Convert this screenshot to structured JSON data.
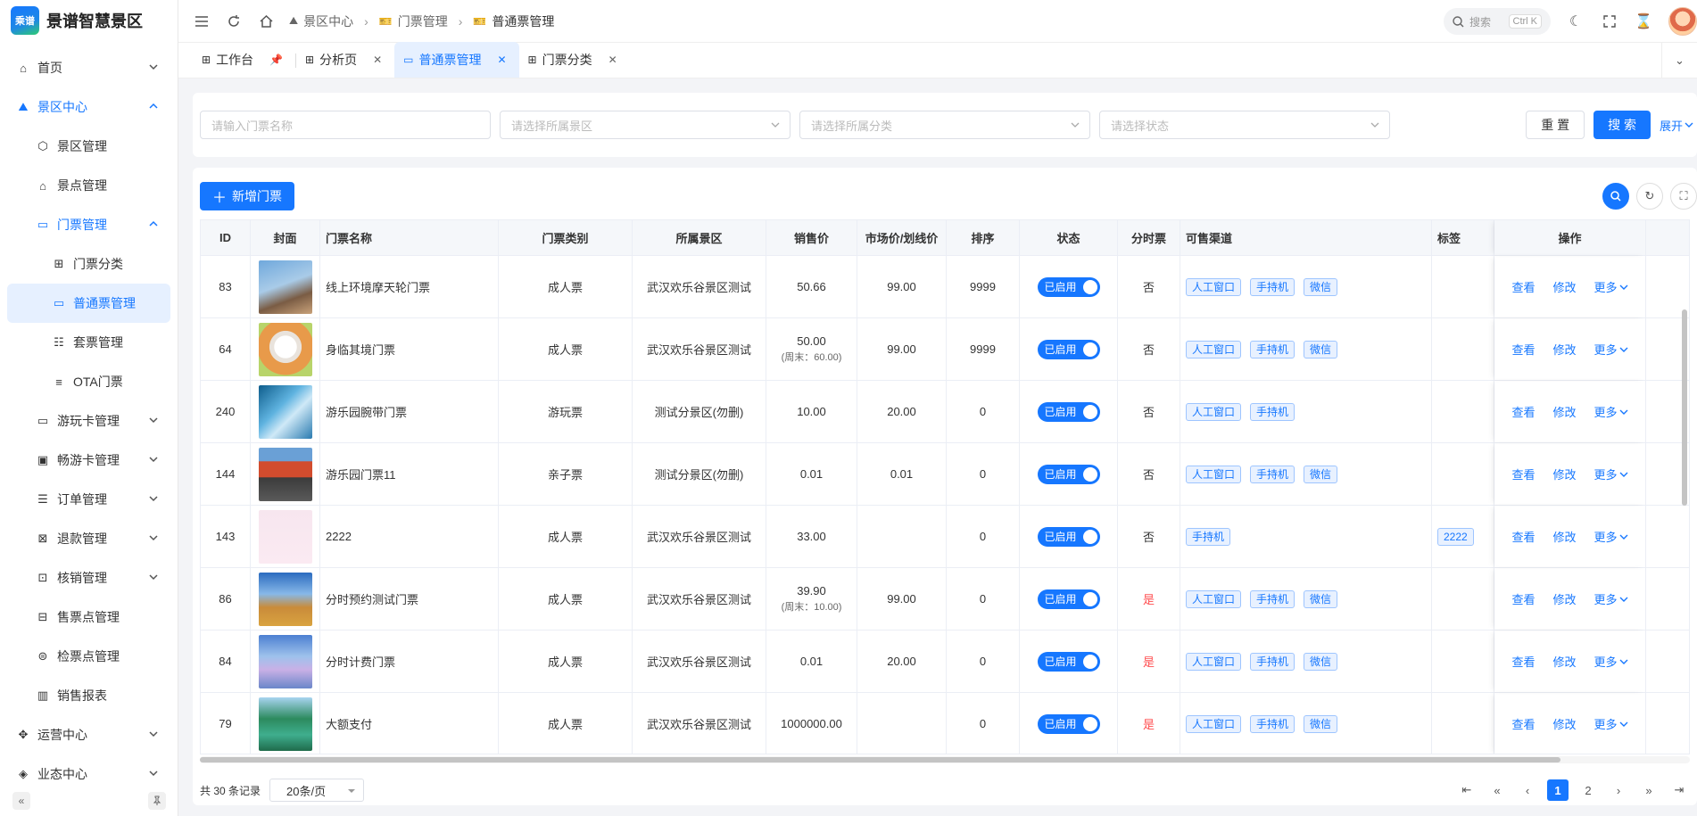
{
  "brand": {
    "logo_text": "乘谱",
    "title": "景谱智慧景区"
  },
  "sidebar": {
    "items": [
      {
        "label": "首页",
        "level": 0,
        "expandable": true,
        "expanded": false
      },
      {
        "label": "景区中心",
        "level": 0,
        "expandable": true,
        "expanded": true,
        "active": true
      },
      {
        "label": "景区管理",
        "level": 1
      },
      {
        "label": "景点管理",
        "level": 1
      },
      {
        "label": "门票管理",
        "level": 1,
        "expandable": true,
        "expanded": true,
        "active": true
      },
      {
        "label": "门票分类",
        "level": 2
      },
      {
        "label": "普通票管理",
        "level": 2,
        "selected": true
      },
      {
        "label": "套票管理",
        "level": 2
      },
      {
        "label": "OTA门票",
        "level": 2
      },
      {
        "label": "游玩卡管理",
        "level": 1,
        "expandable": true
      },
      {
        "label": "畅游卡管理",
        "level": 1,
        "expandable": true
      },
      {
        "label": "订单管理",
        "level": 1,
        "expandable": true
      },
      {
        "label": "退款管理",
        "level": 1,
        "expandable": true
      },
      {
        "label": "核销管理",
        "level": 1,
        "expandable": true
      },
      {
        "label": "售票点管理",
        "level": 1
      },
      {
        "label": "检票点管理",
        "level": 1
      },
      {
        "label": "销售报表",
        "level": 1
      },
      {
        "label": "运营中心",
        "level": 0,
        "expandable": true
      },
      {
        "label": "业态中心",
        "level": 0,
        "expandable": true
      }
    ]
  },
  "header": {
    "breadcrumb": [
      "景区中心",
      "门票管理",
      "普通票管理"
    ],
    "search_placeholder": "搜索",
    "search_shortcut": "Ctrl K"
  },
  "tabs": [
    {
      "label": "工作台",
      "pinned": true
    },
    {
      "label": "分析页",
      "closable": true
    },
    {
      "label": "普通票管理",
      "closable": true,
      "active": true
    },
    {
      "label": "门票分类",
      "closable": true
    }
  ],
  "filters": {
    "name_placeholder": "请输入门票名称",
    "scenic_placeholder": "请选择所属景区",
    "category_placeholder": "请选择所属分类",
    "status_placeholder": "请选择状态",
    "reset_label": "重 置",
    "search_label": "搜 索",
    "expand_label": "展开"
  },
  "toolbar": {
    "add_label": "新增门票"
  },
  "table": {
    "columns": [
      "ID",
      "封面",
      "门票名称",
      "门票类别",
      "所属景区",
      "销售价",
      "市场价/划线价",
      "排序",
      "状态",
      "分时票",
      "可售渠道",
      "标签",
      "操作"
    ],
    "rows": [
      {
        "id": "83",
        "name": "线上环境摩天轮门票",
        "type": "成人票",
        "scenic": "武汉欢乐谷景区测试",
        "price": "50.66",
        "price_sub": "",
        "market": "99.00",
        "sort": "9999",
        "status": "已启用",
        "timed": "否",
        "timed_red": false,
        "channels": [
          "人工窗口",
          "手持机",
          "微信"
        ],
        "tags": [],
        "cover": "ferris"
      },
      {
        "id": "64",
        "name": "身临其境门票",
        "type": "成人票",
        "scenic": "武汉欢乐谷景区测试",
        "price": "50.00",
        "price_sub": "(周末：60.00)",
        "market": "99.00",
        "sort": "9999",
        "status": "已启用",
        "timed": "否",
        "timed_red": false,
        "channels": [
          "人工窗口",
          "手持机",
          "微信"
        ],
        "tags": [],
        "cover": "bunny"
      },
      {
        "id": "240",
        "name": "游乐园腕带门票",
        "type": "游玩票",
        "scenic": "测试分景区(勿删)",
        "price": "10.00",
        "price_sub": "",
        "market": "20.00",
        "sort": "0",
        "status": "已启用",
        "timed": "否",
        "timed_red": false,
        "channels": [
          "人工窗口",
          "手持机"
        ],
        "tags": [],
        "cover": "ice"
      },
      {
        "id": "144",
        "name": "游乐园门票11",
        "type": "亲子票",
        "scenic": "测试分景区(勿删)",
        "price": "0.01",
        "price_sub": "",
        "market": "0.01",
        "sort": "0",
        "status": "已启用",
        "timed": "否",
        "timed_red": false,
        "channels": [
          "人工窗口",
          "手持机",
          "微信"
        ],
        "tags": [],
        "cover": "shop"
      },
      {
        "id": "143",
        "name": "2222",
        "type": "成人票",
        "scenic": "武汉欢乐谷景区测试",
        "price": "33.00",
        "price_sub": "",
        "market": "",
        "sort": "0",
        "status": "已启用",
        "timed": "否",
        "timed_red": false,
        "channels": [
          "手持机"
        ],
        "tags": [
          "2222"
        ],
        "cover": "pink"
      },
      {
        "id": "86",
        "name": "分时预约测试门票",
        "type": "成人票",
        "scenic": "武汉欢乐谷景区测试",
        "price": "39.90",
        "price_sub": "(周末：10.00)",
        "market": "99.00",
        "sort": "0",
        "status": "已启用",
        "timed": "是",
        "timed_red": true,
        "channels": [
          "人工窗口",
          "手持机",
          "微信"
        ],
        "tags": [],
        "cover": "park"
      },
      {
        "id": "84",
        "name": "分时计费门票",
        "type": "成人票",
        "scenic": "武汉欢乐谷景区测试",
        "price": "0.01",
        "price_sub": "",
        "market": "20.00",
        "sort": "0",
        "status": "已启用",
        "timed": "是",
        "timed_red": true,
        "channels": [
          "人工窗口",
          "手持机",
          "微信"
        ],
        "tags": [],
        "cover": "castle"
      },
      {
        "id": "79",
        "name": "大额支付",
        "type": "成人票",
        "scenic": "武汉欢乐谷景区测试",
        "price": "1000000.00",
        "price_sub": "",
        "market": "",
        "sort": "0",
        "status": "已启用",
        "timed": "是",
        "timed_red": true,
        "channels": [
          "人工窗口",
          "手持机",
          "微信"
        ],
        "tags": [],
        "cover": "lake"
      }
    ],
    "actions": {
      "view": "查看",
      "edit": "修改",
      "more": "更多"
    }
  },
  "pager": {
    "total": "共 30 条记录",
    "page_size": "20条/页",
    "pages": [
      "1",
      "2"
    ],
    "current": "1"
  },
  "colors": {
    "primary": "#1677ff",
    "danger": "#ff4d4f"
  }
}
